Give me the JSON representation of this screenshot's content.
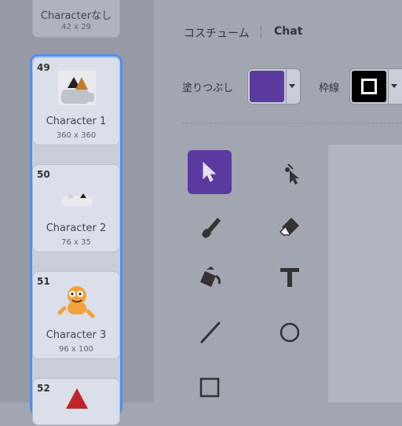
{
  "costumes": [
    {
      "number": "",
      "name": "Characterなし",
      "size": "42 x 29"
    },
    {
      "number": "49",
      "name": "Character 1",
      "size": "360 x 360"
    },
    {
      "number": "50",
      "name": "Character 2",
      "size": "76 x 35"
    },
    {
      "number": "51",
      "name": "Character 3",
      "size": "96 x 100"
    },
    {
      "number": "52",
      "name": "",
      "size": ""
    }
  ],
  "editor": {
    "tabs": [
      "コスチューム",
      "Chat"
    ],
    "fill_label": "塗りつぶし",
    "outline_label": "枠線",
    "fill_color": "#5b3aa0",
    "outline_color": "#000000"
  },
  "tools": [
    {
      "name": "select",
      "icon": "arrow-pointer-icon"
    },
    {
      "name": "reshape",
      "icon": "reshape-icon"
    },
    {
      "name": "brush",
      "icon": "brush-icon"
    },
    {
      "name": "eraser",
      "icon": "eraser-icon"
    },
    {
      "name": "fill",
      "icon": "bucket-icon"
    },
    {
      "name": "text",
      "icon": "text-icon"
    },
    {
      "name": "line",
      "icon": "line-icon"
    },
    {
      "name": "circle",
      "icon": "circle-icon"
    },
    {
      "name": "rectangle",
      "icon": "rectangle-icon"
    }
  ]
}
